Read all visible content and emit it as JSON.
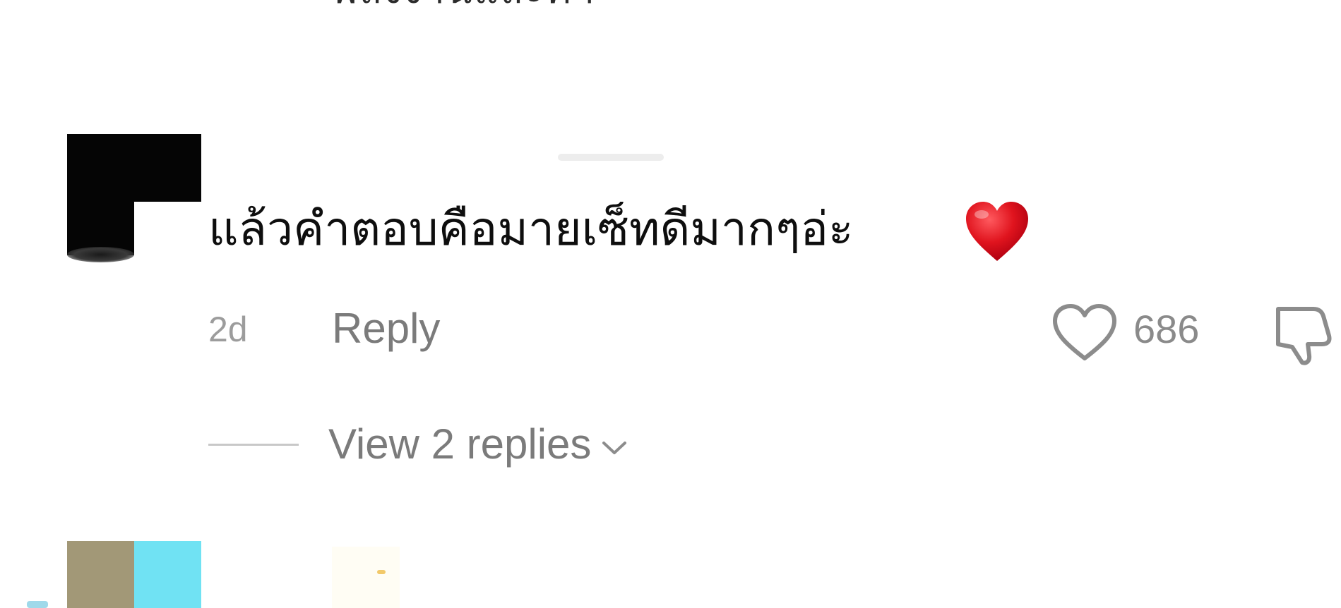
{
  "previous_comment": {
    "text_fragment": "พลังงานและค่า"
  },
  "comment": {
    "text": "แล้วคำตอบคือมายเซ็ทดีมากๆอ่ะ",
    "emoji_icon": "red-heart-emoji",
    "time": "2d",
    "reply_label": "Reply",
    "like_icon": "heart-outline-icon",
    "like_count": "686",
    "dislike_icon": "thumbs-down-outline-icon",
    "view_replies_label": "View 2 replies",
    "view_replies_icon": "chevron-down-icon"
  },
  "colors": {
    "text_primary": "#0e0e0e",
    "text_secondary": "#7b7b7b",
    "emoji_red": "#e0141e",
    "next_avatar_left": "#a29877",
    "next_avatar_right": "#70e2f3"
  }
}
